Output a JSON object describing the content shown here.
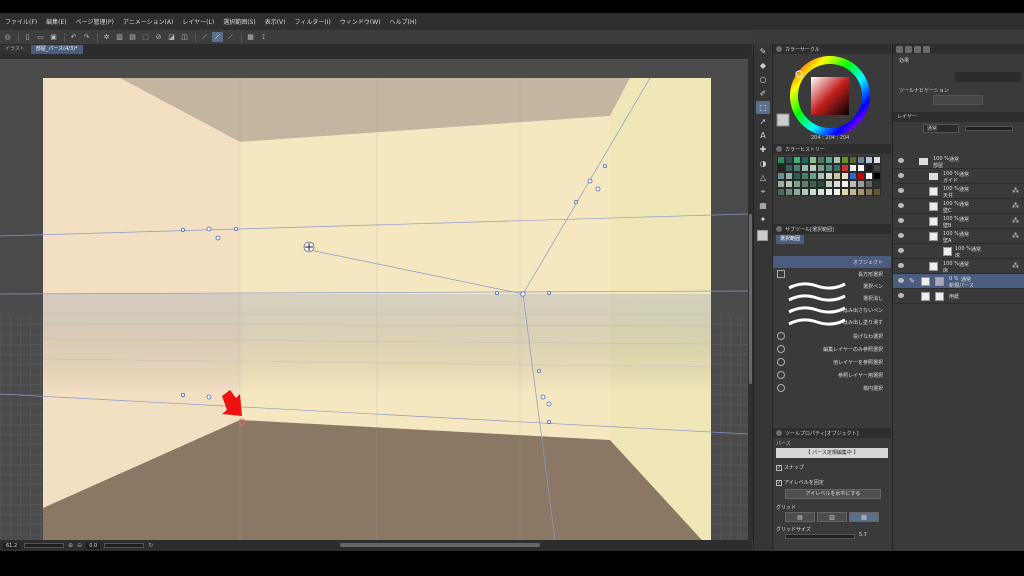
{
  "menubar": {
    "items": [
      "ファイル(F)",
      "編集(E)",
      "ページ管理(P)",
      "アニメーション(A)",
      "レイヤー(L)",
      "選択範囲(S)",
      "表示(V)",
      "フィルター(I)",
      "ウィンドウ(W)",
      "ヘルプ(H)"
    ]
  },
  "tabs": [
    "イラスト",
    "部屋_パース(4/3)*"
  ],
  "status": {
    "zoom": "61.2",
    "angle": "0.0"
  },
  "panels": {
    "color_wheel": {
      "title": "カラーサークル",
      "rgb": "204 : 204 : 204"
    },
    "color_history": {
      "title": "カラーヒストリー"
    },
    "sub_tool": {
      "header": "サブツール[選択範囲]",
      "tab": "選択範囲",
      "items": [
        "オブジェクト",
        "長方形選択",
        "選択ペン",
        "選択消し",
        "はみ出さないペン",
        "はみ出し塗り潰す",
        "投げなわ選択",
        "編集レイヤーのみ参照選択",
        "他レイヤーを参照選択",
        "参照レイヤー用選択",
        "楕円選択"
      ]
    },
    "tool_property": {
      "header": "ツールプロパティ[オブジェクト]",
      "sub": "パース",
      "banner": "【 パース定規編集中 】",
      "snap": "スナップ",
      "eye_level_fix": "アイレベルを固定",
      "eye_level_button": "アイレベルを水平にする",
      "grid": "グリッド",
      "grid_size": "グリッドサイズ",
      "grid_size_value": "5.7"
    },
    "effects": {
      "title": "効果"
    },
    "navigator": {
      "title": "ツールナビゲーション"
    },
    "layers": {
      "title": "レイヤー",
      "blend": "通常",
      "items": [
        {
          "pct": "100 %",
          "mode": "通常",
          "name": "部屋"
        },
        {
          "pct": "100 %",
          "mode": "通常",
          "name": "ガイド"
        },
        {
          "pct": "100 %",
          "mode": "通常",
          "name": "天井"
        },
        {
          "pct": "100 %",
          "mode": "通常",
          "name": "壁C"
        },
        {
          "pct": "100 %",
          "mode": "通常",
          "name": "壁B"
        },
        {
          "pct": "100 %",
          "mode": "通常",
          "name": "壁A"
        },
        {
          "pct": "100 %",
          "mode": "通常",
          "name": "床"
        },
        {
          "pct": "100 %",
          "mode": "通常",
          "name": "床"
        },
        {
          "pct": "0 %",
          "mode": "通常",
          "name": "新規パース"
        },
        {
          "pct": "",
          "mode": "",
          "name": "用紙"
        }
      ]
    }
  },
  "palette": [
    "#2e8b57",
    "#2f4f4f",
    "#3cb371",
    "#1e6b5e",
    "#8fbc8f",
    "#4a7a5a",
    "#5f9e8f",
    "#a0c8b8",
    "#6b8e23",
    "#556b2f",
    "#708090",
    "#b0c4de",
    "#e0e0e0",
    "#222222",
    "#3a5f5f",
    "#4f7f6f",
    "#99bbaa",
    "#bbccbb",
    "#7a9a8a",
    "#5a8a7a",
    "#3f6f5f",
    "#cc3333",
    "#eeeeee",
    "#ffffff",
    "#1a1a1a",
    "#444444",
    "#6e8f8f",
    "#8fafaf",
    "#2d5d4d",
    "#4d7d6d",
    "#6d9d8d",
    "#a5bfb0",
    "#d0d8d0",
    "#c8c8a0",
    "#e8e0c0",
    "#3366cc",
    "#cc0000",
    "#ffffff",
    "#000000",
    "#99b0a0",
    "#b5c5b5",
    "#7f9f8f",
    "#5e7e6e",
    "#3e5e4e",
    "#2a4a3a",
    "#c0d0c0",
    "#dddddd",
    "#f0f0f0",
    "#bbbbbb",
    "#999999",
    "#666666",
    "#333333",
    "#4a6a5a",
    "#6a8a7a",
    "#8aaa9a",
    "#aacaba",
    "#cadada",
    "#dae5e0",
    "#eaf0ea",
    "#f5f5e8",
    "#e0d8b0",
    "#c0b890",
    "#a09870",
    "#807850",
    "#605830"
  ]
}
